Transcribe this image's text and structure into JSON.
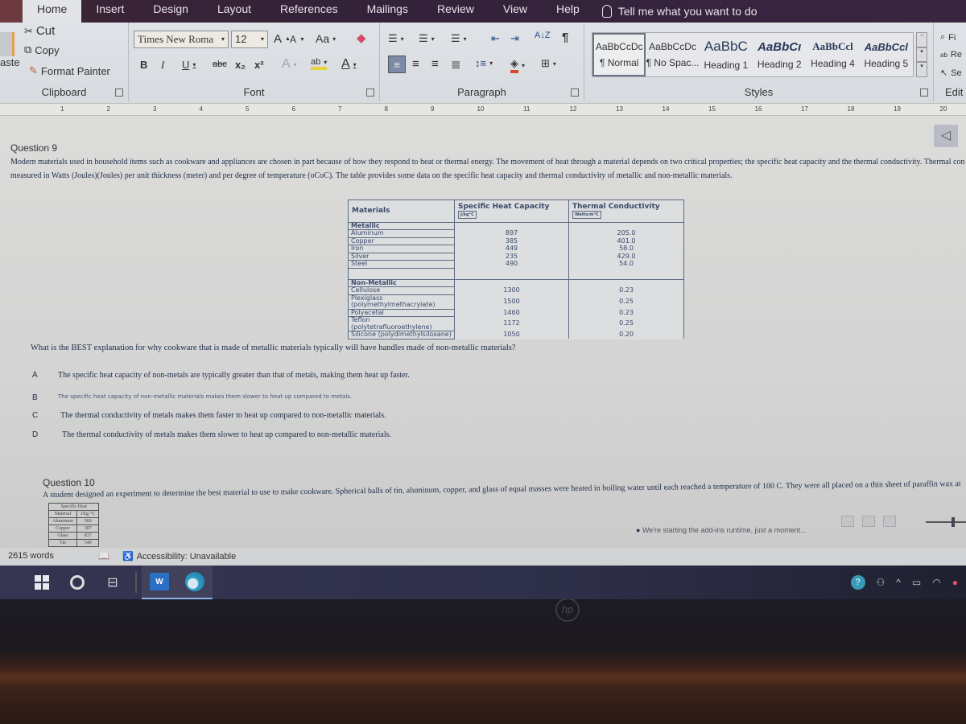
{
  "ribbon_tabs": [
    "Home",
    "Insert",
    "Design",
    "Layout",
    "References",
    "Mailings",
    "Review",
    "View",
    "Help"
  ],
  "active_tab": "Home",
  "tell_me": "Tell me what you want to do",
  "clipboard": {
    "paste_label": "aste",
    "cut": "Cut",
    "copy": "Copy",
    "format_painter": "Format Painter",
    "group_label": "Clipboard"
  },
  "font": {
    "font_name": "Times New Roma",
    "font_size": "12",
    "grow": "A",
    "shrink": "A",
    "change_case": "Aa",
    "bold": "B",
    "italic": "I",
    "underline": "U",
    "strikethrough": "abc",
    "subscript": "x₂",
    "superscript": "x²",
    "text_effects": "A",
    "highlight": "ab",
    "font_color": "A",
    "group_label": "Font"
  },
  "paragraph": {
    "group_label": "Paragraph",
    "sort": "A↓Z",
    "pilcrow": "¶"
  },
  "styles": {
    "group_label": "Styles",
    "items": [
      {
        "sample": "AaBbCcDc",
        "label": "¶ Normal"
      },
      {
        "sample": "AaBbCcDc",
        "label": "¶ No Spac..."
      },
      {
        "sample": "AaBbC",
        "label": "Heading 1"
      },
      {
        "sample": "AaBbCı",
        "label": "Heading 2"
      },
      {
        "sample": "AaBbCcl",
        "label": "Heading 4"
      },
      {
        "sample": "AaBbCcl",
        "label": "Heading 5"
      }
    ]
  },
  "editing": {
    "find": "Fi",
    "replace": "Re",
    "select": "Se",
    "group_label": "Edit"
  },
  "ruler_numbers": [
    "1",
    "2",
    "3",
    "4",
    "5",
    "6",
    "7",
    "8",
    "9",
    "10",
    "11",
    "12",
    "13",
    "14",
    "15",
    "16",
    "17",
    "18",
    "19",
    "20"
  ],
  "document": {
    "question9": {
      "title": "Question 9",
      "paragraph_line1": "Modern materials used in household items such as cookware and appliances are chosen in part because of how they respond to heat or thermal energy. The movement of heat through a material depends on two critical properties; the specific heat capacity and the thermal conductivity. Thermal conductivity is",
      "paragraph_line2": "measured in Watts (Joules)(Joules) per unit thickness (meter) and per degree of temperature (oCoC). The table provides some data on the specific heat capacity and thermal conductivity of metallic and non-metallic materials.",
      "table": {
        "headers": [
          "Materials",
          "Specific Heat Capacity",
          "Thermal Conductivity"
        ],
        "header_units": [
          "J/kg°C",
          "Watts/m°C"
        ],
        "sections": [
          {
            "name": "Metallic",
            "rows": [
              {
                "material": "Aluminum",
                "specific_heat": "897",
                "conductivity": "205.0"
              },
              {
                "material": "Copper",
                "specific_heat": "385",
                "conductivity": "401.0"
              },
              {
                "material": "Iron",
                "specific_heat": "449",
                "conductivity": "58.0"
              },
              {
                "material": "Silver",
                "specific_heat": "235",
                "conductivity": "429.0"
              },
              {
                "material": "Steel",
                "specific_heat": "490",
                "conductivity": "54.0"
              }
            ]
          },
          {
            "name": "Non-Metallic",
            "rows": [
              {
                "material": "Cellulose",
                "specific_heat": "1300",
                "conductivity": "0.23"
              },
              {
                "material": "Plexiglass (polymethylmethacrylate)",
                "specific_heat": "1500",
                "conductivity": "0.25"
              },
              {
                "material": "Polyacetal",
                "specific_heat": "1460",
                "conductivity": "0.23"
              },
              {
                "material": "Teflon (polytetrafluoroethylene)",
                "specific_heat": "1172",
                "conductivity": "0.25"
              },
              {
                "material": "Silicone (polydimethylsiloxane)",
                "specific_heat": "1050",
                "conductivity": "0.20"
              }
            ]
          }
        ]
      },
      "stem": "What is the BEST explanation for why cookware that is made of metallic materials typically will have handles made of non-metallic materials?",
      "options": [
        {
          "letter": "A",
          "text": "The specific heat capacity of non-metals are typically greater than that of metals, making them heat up faster."
        },
        {
          "letter": "B",
          "text": "The specific heat capacity of non-metallic materials makes them slower to heat up compared to metals."
        },
        {
          "letter": "C",
          "text": "The thermal conductivity of metals makes them faster to heat up compared to non-metallic materials."
        },
        {
          "letter": "D",
          "text": "The thermal conductivity of metals makes them slower to heat up compared to non-metallic materials."
        }
      ]
    },
    "question10": {
      "title": "Question 10",
      "paragraph": "A student designed an experiment to determine the best material to use to make cookware. Spherical balls of tin, aluminum, copper, and glass of equal masses were heated in boiling water until each reached a temperature of 100 C. They were all placed on a thin sheet of paraffin wax at the same time.",
      "mini_table": {
        "title": "Specific Heat",
        "headers": [
          "Material",
          "J/kg·°C"
        ],
        "rows": [
          [
            "Aluminum",
            "900"
          ],
          [
            "Copper",
            "387"
          ],
          [
            "Glass",
            "837"
          ],
          [
            "Tin",
            "540"
          ]
        ]
      }
    }
  },
  "status": {
    "word_count": "2615 words",
    "accessibility": "Accessibility: Unavailable",
    "addins_message": "We're starting the add-ins runtime, just a moment..."
  },
  "taskbar": {
    "word_label": "W"
  },
  "bezel_logo": "hp"
}
